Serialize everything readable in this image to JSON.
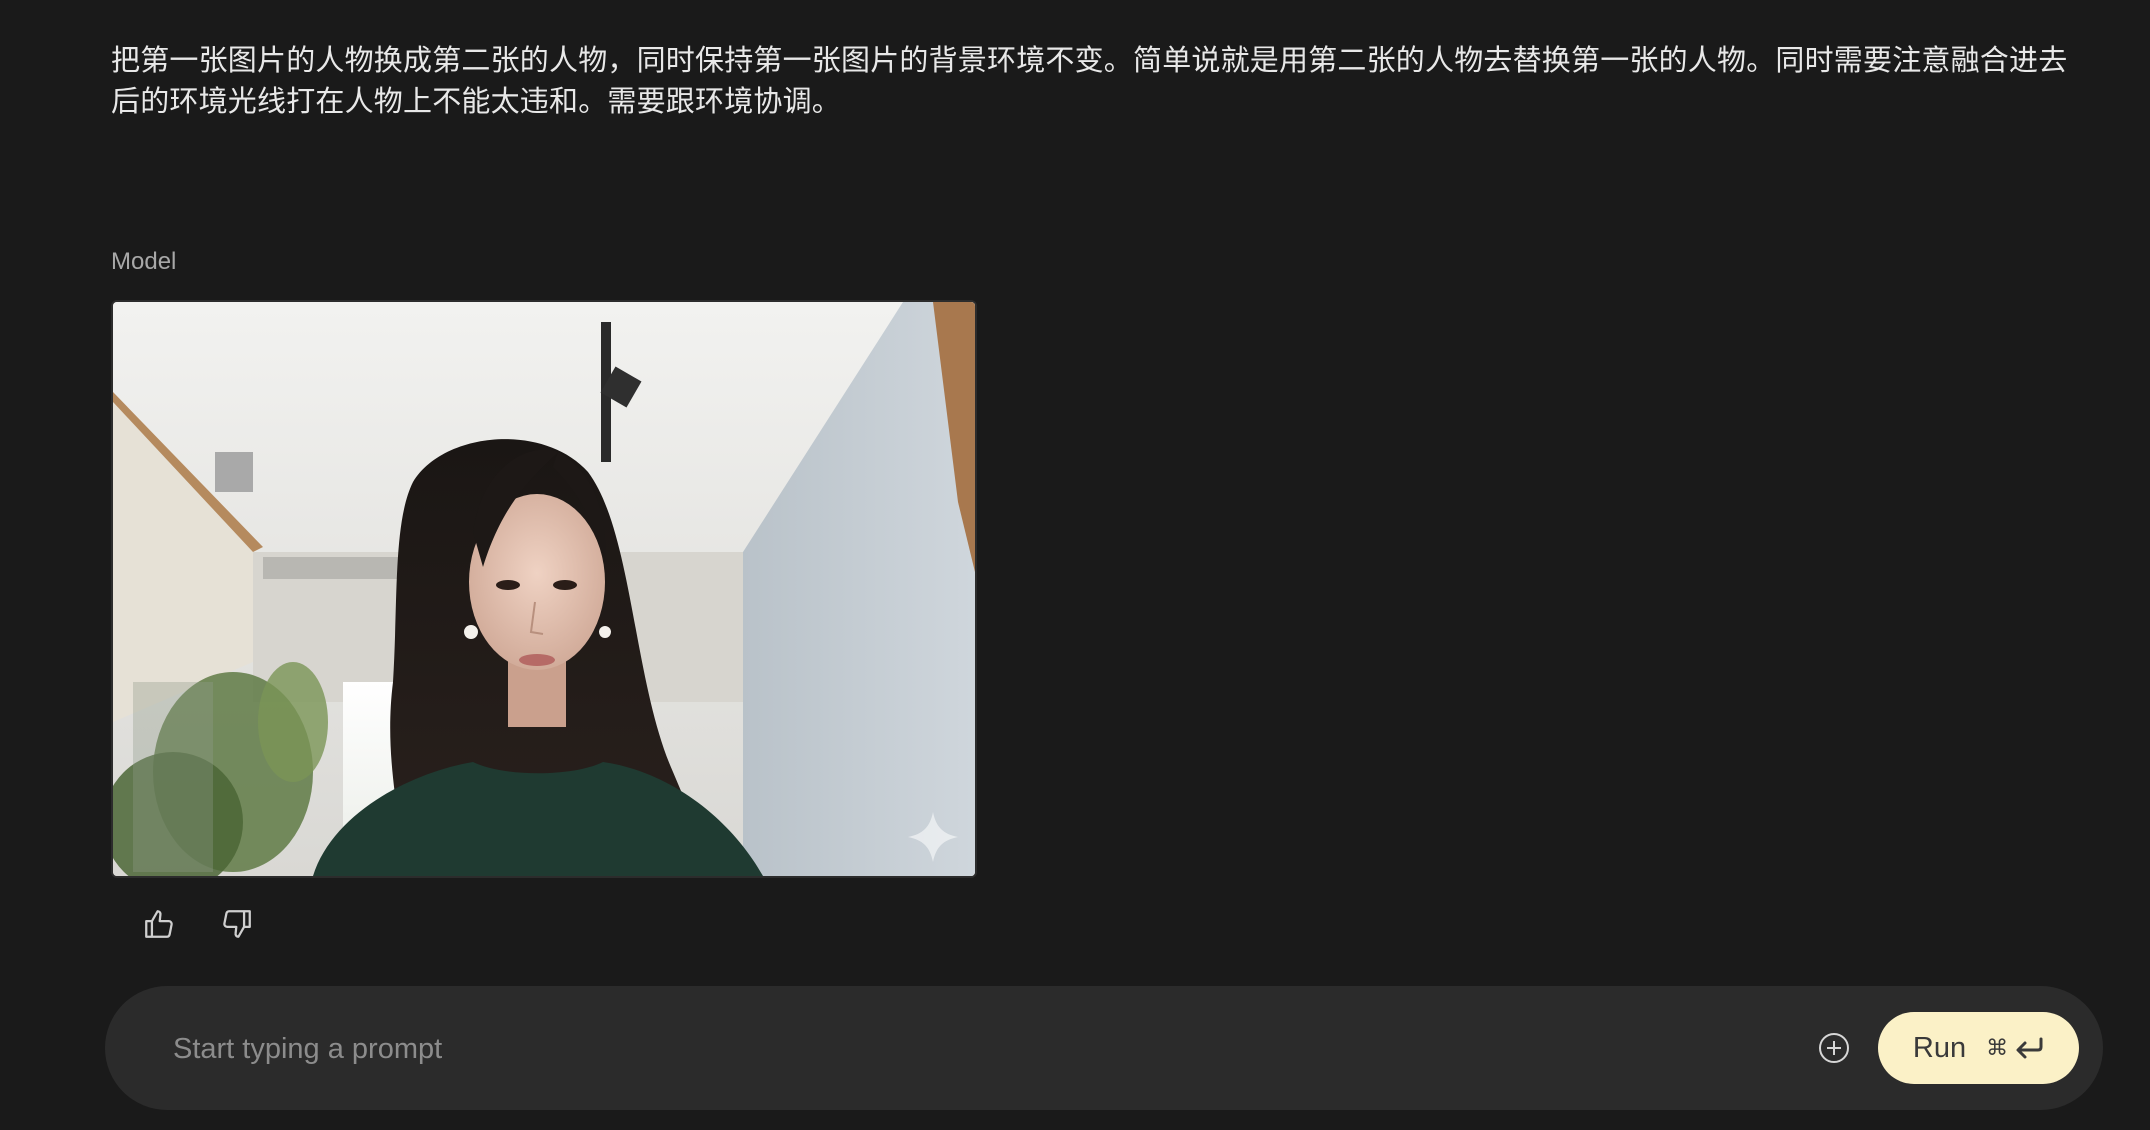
{
  "conversation": {
    "user_message": "把第一张图片的人物换成第二张的人物，同时保持第一张图片的背景环境不变。简单说就是用第二张的人物去替换第一张的人物。同时需要注意融合进去后的环境光线打在人物上不能太违和。需要跟环境协调。",
    "model_label": "Model"
  },
  "response": {
    "image_icon": "image",
    "feedback": {
      "like_icon": "thumbs-up-icon",
      "dislike_icon": "thumbs-down-icon"
    }
  },
  "prompt": {
    "placeholder": "Start typing a prompt",
    "add_icon": "plus-circle-icon",
    "run_label": "Run",
    "shortcut_symbol": "⌘",
    "shortcut_icon": "enter-icon"
  },
  "colors": {
    "background": "#1a1a1a",
    "prompt_bar": "#2b2b2b",
    "run_button": "#fbf1c7"
  }
}
